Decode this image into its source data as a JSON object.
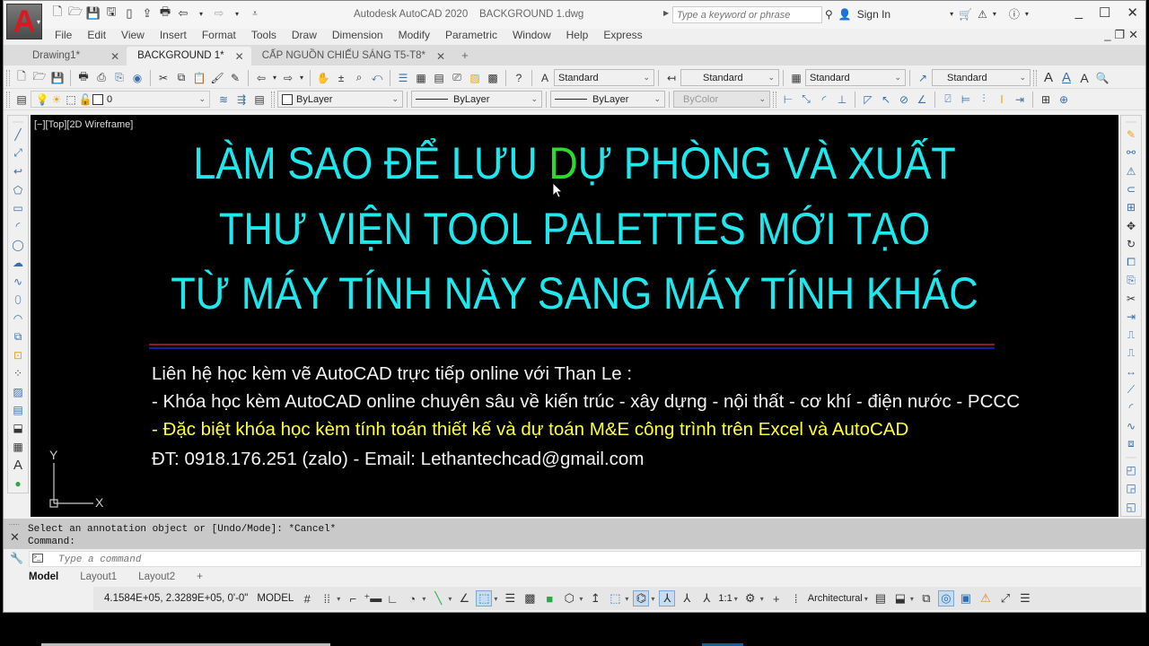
{
  "app": {
    "title": "Autodesk AutoCAD 2020",
    "document": "BACKGROUND 1.dwg",
    "app_button_letter": "A"
  },
  "search": {
    "placeholder": "Type a keyword or phrase"
  },
  "account": {
    "sign_in": "Sign In"
  },
  "menu": [
    "File",
    "Edit",
    "View",
    "Insert",
    "Format",
    "Tools",
    "Draw",
    "Dimension",
    "Modify",
    "Parametric",
    "Window",
    "Help",
    "Express"
  ],
  "tabs": [
    {
      "label": "Drawing1*",
      "active": false
    },
    {
      "label": "BACKGROUND 1*",
      "active": true
    },
    {
      "label": "CẤP NGUỒN CHIẾU SÁNG T5-T8*",
      "active": false
    }
  ],
  "styles": {
    "text_style": "Standard",
    "dim_style": "Standard",
    "table_style": "Standard",
    "mleader_style": "Standard"
  },
  "layers": {
    "current_layer": "0",
    "color": "ByLayer",
    "linetype": "ByLayer",
    "lineweight": "ByLayer",
    "plot_style": "ByColor"
  },
  "viewport": {
    "label": "[−][Top][2D Wireframe]"
  },
  "drawing": {
    "headline": [
      {
        "pre": "LÀM SAO ĐỂ LƯU ",
        "hl": "D",
        "post": "Ự PHÒNG VÀ XUẤT"
      },
      {
        "pre": "THƯ VIỆN TOOL PALETTES MỚI TẠO",
        "hl": "",
        "post": ""
      },
      {
        "pre": "TỪ MÁY TÍNH NÀY SANG MÁY TÍNH KHÁC",
        "hl": "",
        "post": ""
      }
    ],
    "info": [
      "Liên hệ học kèm vẽ AutoCAD trực tiếp online với Than Le :",
      "- Khóa học kèm AutoCAD online chuyên sâu về kiến trúc - xây dựng - nội thất - cơ khí - điện nước - PCCC",
      "- Đặc biệt khóa học kèm tính toán thiết kế và dự toán M&E công trình trên Excel và AutoCAD",
      "ĐT: 0918.176.251 (zalo)  - Email: Lethantechcad@gmail.com"
    ],
    "colors": {
      "headline": "#1ee8ee",
      "highlight": "#2ed92e",
      "info": "#f2f2f2",
      "info_highlight": "#ffff33"
    },
    "ucs": {
      "x": "X",
      "y": "Y"
    }
  },
  "command": {
    "history": [
      "Select an annotation object or [Undo/Mode]: *Cancel*",
      "Command:"
    ],
    "placeholder": "Type a command"
  },
  "layout_tabs": [
    {
      "label": "Model",
      "active": true
    },
    {
      "label": "Layout1",
      "active": false
    },
    {
      "label": "Layout2",
      "active": false
    }
  ],
  "status": {
    "coordinates": "4.1584E+05, 2.3289E+05, 0'-0\"",
    "space": "MODEL",
    "annotation_scale": "1:1",
    "units": "Architectural"
  }
}
